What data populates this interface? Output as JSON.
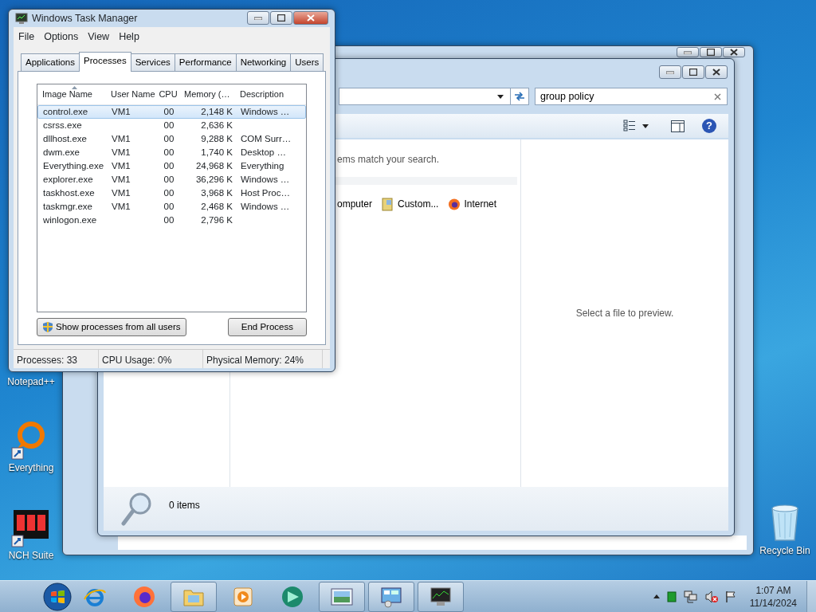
{
  "desktop_icons": [
    {
      "label": "Notepad++"
    },
    {
      "label": "Everything"
    },
    {
      "label": "NCH Suite"
    },
    {
      "label": "Recycle Bin"
    }
  ],
  "explorer": {
    "help_glyph": "?",
    "search": {
      "value": "group policy"
    },
    "message": "ems match your search.",
    "items": [
      {
        "label": "omputer"
      },
      {
        "label": "Custom..."
      },
      {
        "label": "Internet"
      }
    ],
    "preview_message": "Select a file to preview.",
    "status": "0 items"
  },
  "task_manager": {
    "title": "Windows Task Manager",
    "menu": [
      "File",
      "Options",
      "View",
      "Help"
    ],
    "tabs": [
      {
        "label": "Applications",
        "selected": false
      },
      {
        "label": "Processes",
        "selected": true
      },
      {
        "label": "Services",
        "selected": false
      },
      {
        "label": "Performance",
        "selected": false
      },
      {
        "label": "Networking",
        "selected": false
      },
      {
        "label": "Users",
        "selected": false
      }
    ],
    "columns": [
      "Image Name",
      "User Name",
      "CPU",
      "Memory (…",
      "Description"
    ],
    "rows": [
      {
        "cells": [
          "control.exe",
          "VM1",
          "00",
          "2,148 K",
          "Windows …"
        ],
        "selected": true
      },
      {
        "cells": [
          "csrss.exe",
          "",
          "00",
          "2,636 K",
          ""
        ],
        "selected": false
      },
      {
        "cells": [
          "dllhost.exe",
          "VM1",
          "00",
          "9,288 K",
          "COM Surr…"
        ],
        "selected": false
      },
      {
        "cells": [
          "dwm.exe",
          "VM1",
          "00",
          "1,740 K",
          "Desktop …"
        ],
        "selected": false
      },
      {
        "cells": [
          "Everything.exe",
          "VM1",
          "00",
          "24,968 K",
          "Everything"
        ],
        "selected": false
      },
      {
        "cells": [
          "explorer.exe",
          "VM1",
          "00",
          "36,296 K",
          "Windows …"
        ],
        "selected": false
      },
      {
        "cells": [
          "taskhost.exe",
          "VM1",
          "00",
          "3,968 K",
          "Host Proc…"
        ],
        "selected": false
      },
      {
        "cells": [
          "taskmgr.exe",
          "VM1",
          "00",
          "2,468 K",
          "Windows …"
        ],
        "selected": false
      },
      {
        "cells": [
          "winlogon.exe",
          "",
          "00",
          "2,796 K",
          ""
        ],
        "selected": false
      }
    ],
    "buttons": [
      "Show processes from all users",
      "End Process"
    ],
    "status_bar": [
      "Processes: 33",
      "CPU Usage: 0%",
      "Physical Memory: 24%"
    ]
  },
  "taskbar": {
    "apps": [
      {
        "running": false
      },
      {
        "running": false
      },
      {
        "running": true
      },
      {
        "running": false
      },
      {
        "running": false
      },
      {
        "running": true
      },
      {
        "running": true
      },
      {
        "running": true
      }
    ],
    "clock": {
      "time": "1:07 AM",
      "date": "11/14/2024"
    }
  }
}
